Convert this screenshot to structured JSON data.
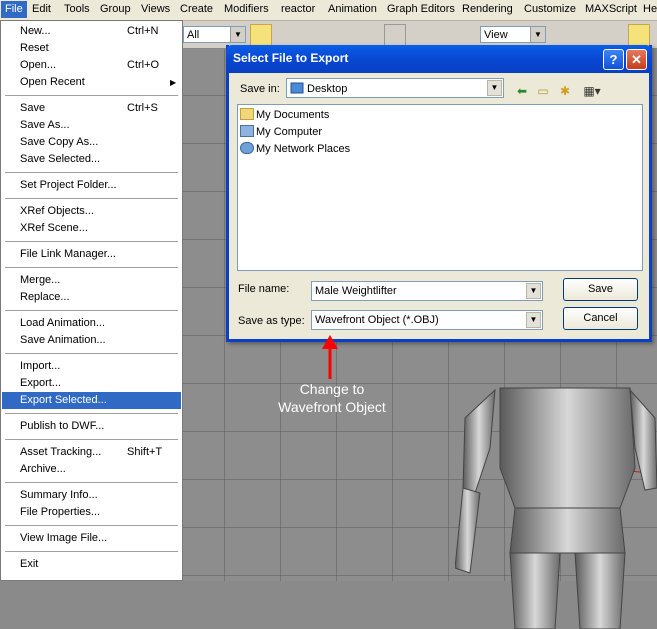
{
  "menubar": {
    "items": [
      "File",
      "Edit",
      "Tools",
      "Group",
      "Views",
      "Create",
      "Modifiers",
      "reactor",
      "Animation",
      "Graph Editors",
      "Rendering",
      "Customize",
      "MAXScript",
      "He"
    ]
  },
  "toolbar": {
    "selection_filter": "All",
    "reference_coord": "View"
  },
  "file_menu": {
    "items": [
      {
        "label": "New...",
        "shortcut": "Ctrl+N"
      },
      {
        "label": "Reset",
        "shortcut": ""
      },
      {
        "label": "Open...",
        "shortcut": "Ctrl+O"
      },
      {
        "label": "Open Recent",
        "shortcut": "",
        "submenu": "▶"
      },
      {
        "label": "Save",
        "shortcut": "Ctrl+S"
      },
      {
        "label": "Save As...",
        "shortcut": ""
      },
      {
        "label": "Save Copy As...",
        "shortcut": ""
      },
      {
        "label": "Save Selected...",
        "shortcut": ""
      },
      {
        "label": "Set Project Folder...",
        "shortcut": ""
      },
      {
        "label": "XRef Objects...",
        "shortcut": ""
      },
      {
        "label": "XRef Scene...",
        "shortcut": ""
      },
      {
        "label": "File Link Manager...",
        "shortcut": ""
      },
      {
        "label": "Merge...",
        "shortcut": ""
      },
      {
        "label": "Replace...",
        "shortcut": ""
      },
      {
        "label": "Load Animation...",
        "shortcut": ""
      },
      {
        "label": "Save Animation...",
        "shortcut": ""
      },
      {
        "label": "Import...",
        "shortcut": ""
      },
      {
        "label": "Export...",
        "shortcut": ""
      },
      {
        "label": "Export Selected...",
        "shortcut": ""
      },
      {
        "label": "Publish to DWF...",
        "shortcut": ""
      },
      {
        "label": "Asset Tracking...",
        "shortcut": "Shift+T"
      },
      {
        "label": "Archive...",
        "shortcut": ""
      },
      {
        "label": "Summary Info...",
        "shortcut": ""
      },
      {
        "label": "File Properties...",
        "shortcut": ""
      },
      {
        "label": "View Image File...",
        "shortcut": ""
      },
      {
        "label": "Exit",
        "shortcut": ""
      }
    ],
    "selected": "Export Selected..."
  },
  "dialog": {
    "title": "Select File to Export",
    "help_glyph": "?",
    "close_glyph": "✕",
    "save_in_label": "Save in:",
    "save_in_value": "Desktop",
    "places": [
      "My Documents",
      "My Computer",
      "My Network Places"
    ],
    "file_name_label": "File name:",
    "file_name_value": "Male Weightlifter",
    "save_as_type_label": "Save as type:",
    "save_as_type_value": "Wavefront Object (*.OBJ)",
    "save_button": "Save",
    "cancel_button": "Cancel"
  },
  "annotation": {
    "line1": "Change to",
    "line2": "Wavefront Object",
    "color": "#ff0000"
  },
  "colors": {
    "menu_highlight": "#316ac5",
    "titlebar": "#0a4fd6"
  }
}
